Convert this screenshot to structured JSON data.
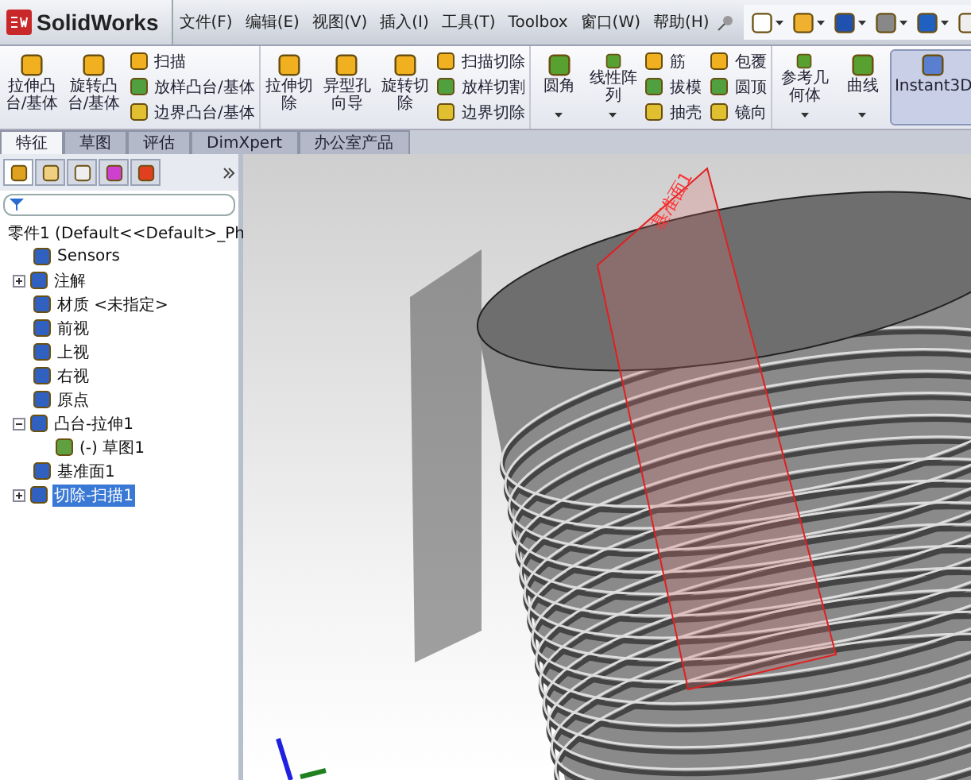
{
  "app": {
    "name": "SolidWorks"
  },
  "menu": [
    "文件(F)",
    "编辑(E)",
    "视图(V)",
    "插入(I)",
    "工具(T)",
    "Toolbox",
    "窗口(W)",
    "帮助(H)"
  ],
  "ribbon": [
    [
      {
        "kind": "big",
        "label": "拉伸凸台/基体"
      },
      {
        "kind": "big",
        "label": "旋转凸台/基体"
      },
      {
        "kind": "stack",
        "items": [
          "扫描",
          "放样凸台/基体",
          "边界凸台/基体"
        ]
      }
    ],
    [
      {
        "kind": "big",
        "label": "拉伸切除"
      },
      {
        "kind": "big",
        "label": "异型孔向导"
      },
      {
        "kind": "big",
        "label": "旋转切除"
      },
      {
        "kind": "stack",
        "items": [
          "扫描切除",
          "放样切割",
          "边界切除"
        ]
      }
    ],
    [
      {
        "kind": "dropdown",
        "label": "圆角"
      },
      {
        "kind": "dropdown",
        "label": "线性阵列"
      },
      {
        "kind": "stack",
        "items": [
          "筋",
          "拔模",
          "抽壳"
        ]
      },
      {
        "kind": "stack",
        "items": [
          "包覆",
          "圆顶",
          "镜向"
        ]
      }
    ],
    [
      {
        "kind": "dropdown",
        "label": "参考几何体"
      },
      {
        "kind": "dropdown",
        "label": "曲线"
      },
      {
        "kind": "toggle",
        "label": "Instant3D",
        "selected": true
      }
    ]
  ],
  "command_tabs": [
    {
      "label": "特征",
      "selected": true
    },
    {
      "label": "草图",
      "selected": false
    },
    {
      "label": "评估",
      "selected": false
    },
    {
      "label": "DimXpert",
      "selected": false
    },
    {
      "label": "办公室产品",
      "selected": false
    }
  ],
  "panel_tabs": [
    {
      "selected": true
    },
    {
      "selected": false
    },
    {
      "selected": false
    },
    {
      "selected": false
    },
    {
      "selected": false
    }
  ],
  "tree": {
    "label": "零件1  (Default<<Default>_Ph",
    "selected": false,
    "children": [
      {
        "label": "Sensors",
        "selected": false
      },
      {
        "label": "注解",
        "selected": false,
        "expanded": false
      },
      {
        "label": "材质 <未指定>",
        "selected": false
      },
      {
        "label": "前视",
        "selected": false
      },
      {
        "label": "上视",
        "selected": false
      },
      {
        "label": "右视",
        "selected": false
      },
      {
        "label": "原点",
        "selected": false
      },
      {
        "label": "凸台-拉伸1",
        "selected": false,
        "expanded": true,
        "children": [
          {
            "label": "(-) 草图1",
            "selected": false
          }
        ]
      },
      {
        "label": "基准面1",
        "selected": false
      },
      {
        "label": "切除-扫描1",
        "selected": true,
        "expanded": false
      }
    ]
  },
  "viewport": {
    "plane_label": "基准面1"
  }
}
